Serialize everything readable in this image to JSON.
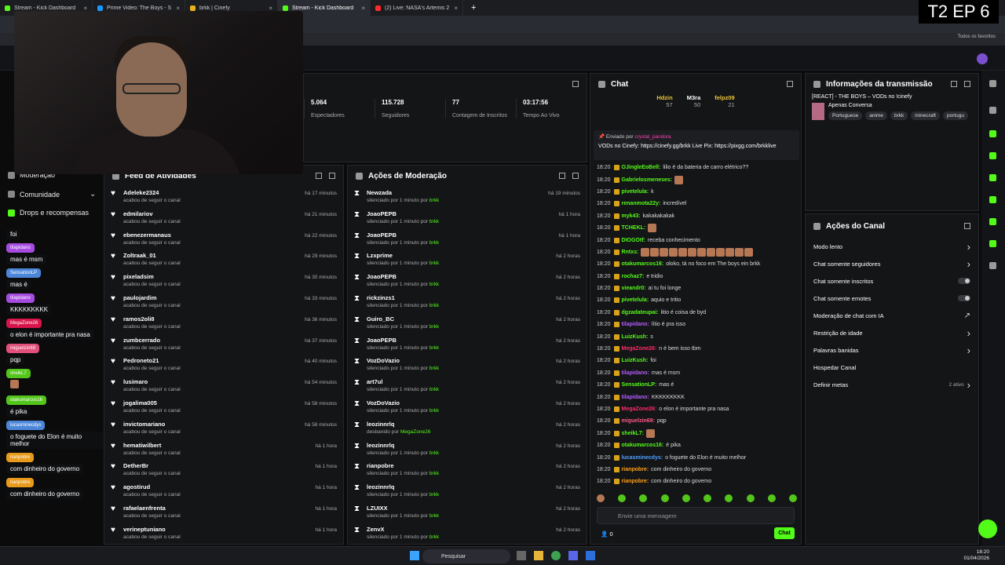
{
  "overlay": {
    "episode": "T2 EP 6"
  },
  "browser": {
    "tabs": [
      {
        "label": "Stream - Kick Dashboard",
        "color": "#53fc18",
        "active": false
      },
      {
        "label": "Prime Video: The Boys - Segun",
        "color": "#1a98ff",
        "active": false
      },
      {
        "label": "brkk | Cinefy",
        "color": "#e9b21a",
        "active": false
      },
      {
        "label": "Stream - Kick Dashboard",
        "color": "#53fc18",
        "active": true
      },
      {
        "label": "(2) Live: NASA's Artemis 2 -",
        "color": "#ff2b2b",
        "active": false
      }
    ],
    "bookmarks_label": "Todos os favoritos"
  },
  "sidebar": {
    "moderation": "Moderação",
    "community": "Comunidade",
    "drops": "Drops e recompensas"
  },
  "left_chat": [
    {
      "user": "",
      "text": "foi",
      "color": ""
    },
    {
      "user": "tilapidano",
      "text": "mas é msm",
      "color": "#a64be0"
    },
    {
      "user": "SensationLP",
      "text": "mas é",
      "color": "#4c86d8"
    },
    {
      "user": "tilapidano",
      "text": "KKKKKKKKK",
      "color": "#a64be0"
    },
    {
      "user": "MegaZone26",
      "text": "o elon é importante pra nasa",
      "color": "#d8144a"
    },
    {
      "user": "miguelzin69",
      "text": "pqp",
      "color": "#e0507b"
    },
    {
      "user": "sheikL7",
      "text": "",
      "color": "#53c51b"
    },
    {
      "user": "otakumarcos16",
      "text": "é pika",
      "color": "#53c51b"
    },
    {
      "user": "lucasminecdys",
      "text": "o foguete do Elon é muito melhor",
      "color": "#4c86d8"
    },
    {
      "user": "rianpobre",
      "text": "com dinheiro do governo",
      "color": "#e89a1a"
    },
    {
      "user": "rianpobre",
      "text": "com dinheiro do governo",
      "color": "#e89a1a"
    }
  ],
  "stats": [
    {
      "value": "5.064",
      "label": "Espectadores"
    },
    {
      "value": "115.728",
      "label": "Seguidores"
    },
    {
      "value": "77",
      "label": "Contagem de Inscritos"
    },
    {
      "value": "03:17:56",
      "label": "Tempo Ao Vivo"
    }
  ],
  "activity": {
    "title": "Feed de Atividades",
    "items": [
      {
        "name": "Adeleke2324",
        "sub": "acabou de seguir o canal",
        "time": "há 17 minutos"
      },
      {
        "name": "edmilariov",
        "sub": "acabou de seguir o canal",
        "time": "há 21 minutos"
      },
      {
        "name": "ebenezermanaus",
        "sub": "acabou de seguir o canal",
        "time": "há 22 minutos"
      },
      {
        "name": "Zoltraak_01",
        "sub": "acabou de seguir o canal",
        "time": "há 29 minutos"
      },
      {
        "name": "pixeladsim",
        "sub": "acabou de seguir o canal",
        "time": "há 30 minutos"
      },
      {
        "name": "paulojardim",
        "sub": "acabou de seguir o canal",
        "time": "há 33 minutos"
      },
      {
        "name": "ramos2oli8",
        "sub": "acabou de seguir o canal",
        "time": "há 36 minutos"
      },
      {
        "name": "zumbcerrado",
        "sub": "acabou de seguir o canal",
        "time": "há 37 minutos"
      },
      {
        "name": "Pedroneto21",
        "sub": "acabou de seguir o canal",
        "time": "há 40 minutos"
      },
      {
        "name": "lusimaro",
        "sub": "acabou de seguir o canal",
        "time": "há 54 minutos"
      },
      {
        "name": "jogalima005",
        "sub": "acabou de seguir o canal",
        "time": "há 58 minutos"
      },
      {
        "name": "invictomariano",
        "sub": "acabou de seguir o canal",
        "time": "há 58 minutos"
      },
      {
        "name": "hematiwilbert",
        "sub": "acabou de seguir o canal",
        "time": "há 1 hora"
      },
      {
        "name": "DetherBr",
        "sub": "acabou de seguir o canal",
        "time": "há 1 hora"
      },
      {
        "name": "agostirud",
        "sub": "acabou de seguir o canal",
        "time": "há 1 hora"
      },
      {
        "name": "rafaelaenfrenta",
        "sub": "acabou de seguir o canal",
        "time": "há 1 hora"
      },
      {
        "name": "verineptuniano",
        "sub": "acabou de seguir o canal",
        "time": "há 1 hora"
      }
    ]
  },
  "moderation": {
    "title": "Ações de Moderação",
    "items": [
      {
        "name": "Newzada",
        "pre": "silenciado por 1 minuto por ",
        "by": "brkk",
        "time": "há 19 minutos"
      },
      {
        "name": "JoaoPEPB",
        "pre": "silenciado por 1 minuto por ",
        "by": "brkk",
        "time": "há 1 hora"
      },
      {
        "name": "JoaoPEPB",
        "pre": "silenciado por 1 minuto por ",
        "by": "brkk",
        "time": "há 1 hora"
      },
      {
        "name": "Lzxprime",
        "pre": "silenciado por 1 minuto por ",
        "by": "brkk",
        "time": "há 2 horas"
      },
      {
        "name": "JoaoPEPB",
        "pre": "silenciado por 1 minuto por ",
        "by": "brkk",
        "time": "há 2 horas"
      },
      {
        "name": "rickzinzs1",
        "pre": "silenciado por 1 minuto por ",
        "by": "brkk",
        "time": "há 2 horas"
      },
      {
        "name": "Guiro_BC",
        "pre": "silenciado por 1 minuto por ",
        "by": "brkk",
        "time": "há 2 horas"
      },
      {
        "name": "JoaoPEPB",
        "pre": "silenciado por 1 minuto por ",
        "by": "brkk",
        "time": "há 2 horas"
      },
      {
        "name": "VozDoVazio",
        "pre": "silenciado por 1 minuto por ",
        "by": "brkk",
        "time": "há 2 horas"
      },
      {
        "name": "art7ul",
        "pre": "silenciado por 1 minuto por ",
        "by": "brkk",
        "time": "há 2 horas"
      },
      {
        "name": "VozDoVazio",
        "pre": "silenciado por 1 minuto por ",
        "by": "brkk",
        "time": "há 2 horas"
      },
      {
        "name": "leozinnrlq",
        "pre": "desbanido por ",
        "by": "MegaZone26",
        "time": "há 2 horas"
      },
      {
        "name": "leozinnrlq",
        "pre": "silenciado por 1 minuto por ",
        "by": "brkk",
        "time": "há 2 horas"
      },
      {
        "name": "rianpobre",
        "pre": "silenciado por 1 minuto por ",
        "by": "brkk",
        "time": "há 2 horas"
      },
      {
        "name": "leozinnrlq",
        "pre": "silenciado por 1 minuto por ",
        "by": "brkk",
        "time": "há 2 horas"
      },
      {
        "name": "LZUIXX",
        "pre": "silenciado por 1 minuto por ",
        "by": "brkk",
        "time": "há 2 horas"
      },
      {
        "name": "ZenvX",
        "pre": "silenciado por 1 minuto por ",
        "by": "brkk",
        "time": "há 2 horas"
      }
    ]
  },
  "chat": {
    "title": "Chat",
    "top": [
      {
        "name": "Hdzin",
        "value": "57"
      },
      {
        "name": "M3ra",
        "value": "50"
      },
      {
        "name": "felpz09",
        "value": "21"
      }
    ],
    "pinned": {
      "header": "Enviado por",
      "user": "crystal_pandora",
      "text": "VODs no Cinefy: https://cinefy.gg/brkk Live Pix: https://pixgg.com/brkklive"
    },
    "messages": [
      {
        "time": "18:20",
        "user": "OJingleEoBell:",
        "color": "#53fc18",
        "text": "lilio é da bateria de carro elétrico??"
      },
      {
        "time": "18:20",
        "user": "Gabrielosmeneses:",
        "color": "#53fc18",
        "text": ""
      },
      {
        "time": "18:20",
        "user": "pivetelula:",
        "color": "#53fc18",
        "text": "k"
      },
      {
        "time": "18:20",
        "user": "renanmota22y:",
        "color": "#53fc18",
        "text": "incredível"
      },
      {
        "time": "18:20",
        "user": "myk43:",
        "color": "#53fc18",
        "text": "kakakakakak"
      },
      {
        "time": "18:20",
        "user": "TCHEKL:",
        "color": "#53fc18",
        "text": ""
      },
      {
        "time": "18:20",
        "user": "DIOGOtf:",
        "color": "#53fc18",
        "text": "receba conhecimento"
      },
      {
        "time": "18:20",
        "user": "Rntxs:",
        "color": "#53fc18",
        "text": ""
      },
      {
        "time": "18:20",
        "user": "otakumarcos16:",
        "color": "#53fc18",
        "text": "oloko, tá no foco em The boys ein brkk"
      },
      {
        "time": "18:20",
        "user": "rochaz7:",
        "color": "#53fc18",
        "text": "e tridio"
      },
      {
        "time": "18:20",
        "user": "vieandr0:",
        "color": "#53fc18",
        "text": "ai tu foi longe"
      },
      {
        "time": "18:20",
        "user": "pivetelula:",
        "color": "#53fc18",
        "text": "aquio e tritio"
      },
      {
        "time": "18:20",
        "user": "dgzadateupai:",
        "color": "#53fc18",
        "text": "litio é coisa de byd"
      },
      {
        "time": "18:20",
        "user": "tilapidano:",
        "color": "#b45cff",
        "text": "lítio é pra isso"
      },
      {
        "time": "18:20",
        "user": "LuizKush:",
        "color": "#53fc18",
        "text": "s"
      },
      {
        "time": "18:20",
        "user": "MegaZone26:",
        "color": "#ff2b6a",
        "text": "n é bem isso tbm"
      },
      {
        "time": "18:20",
        "user": "LuizKush:",
        "color": "#53fc18",
        "text": "foi"
      },
      {
        "time": "18:20",
        "user": "tilapidano:",
        "color": "#b45cff",
        "text": "mas é msm"
      },
      {
        "time": "18:20",
        "user": "SensationLP:",
        "color": "#53fc18",
        "text": "mas é"
      },
      {
        "time": "18:20",
        "user": "tilapidano:",
        "color": "#b45cff",
        "text": "KKKKKKKKK"
      },
      {
        "time": "18:20",
        "user": "MegaZone26:",
        "color": "#ff2b6a",
        "text": "o elon é importante pra nasa"
      },
      {
        "time": "18:20",
        "user": "miguelzin69:",
        "color": "#ff5a8a",
        "text": "pqp"
      },
      {
        "time": "18:20",
        "user": "sheikL7:",
        "color": "#53fc18",
        "text": ""
      },
      {
        "time": "18:20",
        "user": "otakumarcos16:",
        "color": "#53fc18",
        "text": "é pika"
      },
      {
        "time": "18:20",
        "user": "lucasminecdys:",
        "color": "#4ea0ff",
        "text": "o foguete do Elon é muito melhor"
      },
      {
        "time": "18:20",
        "user": "rianpobre:",
        "color": "#ffa21a",
        "text": "com dinheiro do governo"
      },
      {
        "time": "18:20",
        "user": "rianpobre:",
        "color": "#ffa21a",
        "text": "com dinheiro do governo"
      }
    ],
    "input_placeholder": "Envie uma mensagem",
    "send_label": "Chat",
    "count": "0"
  },
  "stream_info": {
    "title": "Informações da transmissão",
    "stream_title": "[REACT] - THE BOYS – VODs no !cinefy",
    "category": "Apenas Conversa",
    "tags": [
      "Portuguese",
      "anime",
      "brkk",
      "minecraft",
      "portugu"
    ]
  },
  "channel_actions": {
    "title": "Ações do Canal",
    "items": [
      {
        "label": "Modo lento",
        "kind": "chevron",
        "extra": ""
      },
      {
        "label": "Chat somente seguidores",
        "kind": "chevron",
        "extra": ""
      },
      {
        "label": "Chat somente inscritos",
        "kind": "toggle",
        "extra": ""
      },
      {
        "label": "Chat somente emotes",
        "kind": "toggle",
        "extra": ""
      },
      {
        "label": "Moderação de chat com IA",
        "kind": "link",
        "extra": ""
      },
      {
        "label": "Restrição de idade",
        "kind": "chevron",
        "extra": ""
      },
      {
        "label": "Palavras banidas",
        "kind": "chevron",
        "extra": ""
      },
      {
        "label": "Hospedar Canal",
        "kind": "none",
        "extra": ""
      },
      {
        "label": "Definir metas",
        "kind": "chevron",
        "extra": "2 ativo"
      }
    ]
  },
  "taskbar": {
    "search": "Pesquisar",
    "time": "18:20",
    "date": "01/04/2026"
  }
}
